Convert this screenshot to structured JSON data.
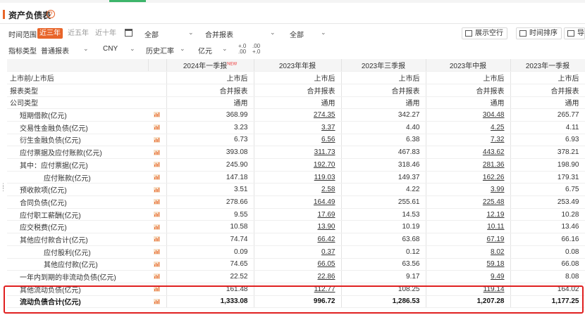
{
  "header": {
    "title": "资产负债表",
    "help_glyph": "?"
  },
  "filters": {
    "time_range_label": "时间范围",
    "time_segments": [
      "近三年",
      "近五年",
      "近十年"
    ],
    "time_selected": "近三年",
    "report_period_select": "全部",
    "report_scope_select": "合并报表",
    "report_class_select": "全部",
    "buttons": {
      "show_empty_rows": "展示空行",
      "time_sort": "时间排序",
      "export": "导"
    },
    "indicator_type_label": "指标类型",
    "indicator_type_select": "普通报表",
    "currency_select": "CNY",
    "rate_select": "历史汇率",
    "unit_select": "亿元",
    "decimal_inc": "+.0\n.00",
    "decimal_dec": ".00\n+.0"
  },
  "table": {
    "columns": [
      "2024年一季报",
      "2023年年报",
      "2023年三季报",
      "2023年中报",
      "2023年一季报"
    ],
    "new_badge": "NEW",
    "info_rows": [
      {
        "label": "上市前/上市后",
        "values": [
          "上市后",
          "上市后",
          "上市后",
          "上市后",
          "上市后"
        ]
      },
      {
        "label": "报表类型",
        "values": [
          "合并报表",
          "合并报表",
          "合并报表",
          "合并报表",
          "合并报表"
        ]
      },
      {
        "label": "公司类型",
        "values": [
          "通用",
          "通用",
          "通用",
          "通用",
          "通用"
        ]
      }
    ],
    "rows": [
      {
        "label": "短期借款(亿元)",
        "indent": 1,
        "values": [
          "368.99",
          "274.35",
          "342.27",
          "304.48",
          "265.77"
        ]
      },
      {
        "label": "交易性金融负债(亿元)",
        "indent": 1,
        "values": [
          "3.23",
          "3.37",
          "4.40",
          "4.25",
          "4.11"
        ]
      },
      {
        "label": "衍生金融负债(亿元)",
        "indent": 1,
        "values": [
          "6.73",
          "6.56",
          "6.38",
          "7.32",
          "6.93"
        ]
      },
      {
        "label": "应付票据及应付账款(亿元)",
        "indent": 1,
        "values": [
          "393.08",
          "311.73",
          "467.83",
          "443.62",
          "378.21"
        ]
      },
      {
        "label": "其中：应付票据(亿元)",
        "indent": 1,
        "values": [
          "245.90",
          "192.70",
          "318.46",
          "281.36",
          "198.90"
        ]
      },
      {
        "label": "应付账款(亿元)",
        "indent": 2,
        "values": [
          "147.18",
          "119.03",
          "149.37",
          "162.26",
          "179.31"
        ]
      },
      {
        "label": "预收款项(亿元)",
        "indent": 1,
        "values": [
          "3.51",
          "2.58",
          "4.22",
          "3.99",
          "6.75"
        ]
      },
      {
        "label": "合同负债(亿元)",
        "indent": 1,
        "values": [
          "278.66",
          "164.49",
          "255.61",
          "225.48",
          "253.49"
        ]
      },
      {
        "label": "应付职工薪酬(亿元)",
        "indent": 1,
        "values": [
          "9.55",
          "17.69",
          "14.53",
          "12.19",
          "10.28"
        ]
      },
      {
        "label": "应交税费(亿元)",
        "indent": 1,
        "values": [
          "10.58",
          "13.90",
          "10.19",
          "10.11",
          "13.46"
        ]
      },
      {
        "label": "其他应付款合计(亿元)",
        "indent": 1,
        "values": [
          "74.74",
          "66.42",
          "63.68",
          "67.19",
          "66.16"
        ]
      },
      {
        "label": "应付股利(亿元)",
        "indent": 2,
        "values": [
          "0.09",
          "0.37",
          "0.12",
          "8.02",
          "0.08"
        ]
      },
      {
        "label": "其他应付款(亿元)",
        "indent": 2,
        "values": [
          "74.65",
          "66.05",
          "63.56",
          "59.18",
          "66.08"
        ]
      },
      {
        "label": "一年内到期的非流动负债(亿元)",
        "indent": 1,
        "values": [
          "22.52",
          "22.86",
          "9.17",
          "9.49",
          "8.08"
        ]
      },
      {
        "label": "其他流动负债(亿元)",
        "indent": 1,
        "values": [
          "161.48",
          "112.77",
          "108.25",
          "119.14",
          "164.02"
        ]
      },
      {
        "label": "流动负债合计(亿元)",
        "indent": 1,
        "bold": true,
        "values": [
          "1,333.08",
          "996.72",
          "1,286.53",
          "1,207.28",
          "1,177.25"
        ]
      }
    ]
  },
  "colors": {
    "accent": "#e8652a",
    "highlight_border": "#e02020",
    "header_bg": "#f5f5f5"
  }
}
